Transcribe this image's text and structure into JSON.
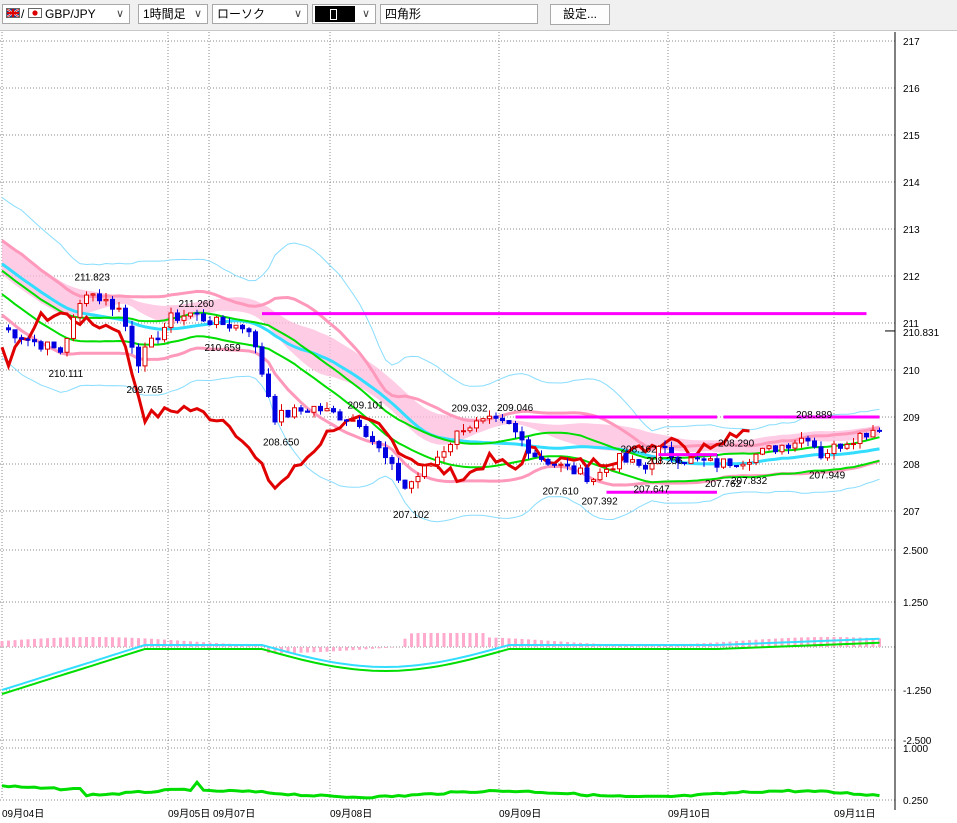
{
  "toolbar": {
    "pair": "GBP/JPY",
    "timeframe": "1時間足",
    "chart_style": "ローソク",
    "drawing_tool": "四角形",
    "settings_label": "設定..."
  },
  "colors": {
    "candle_up": "#e00000",
    "candle_down": "#0000e0",
    "lagging_span": "#e00000",
    "ma_green": "#00dd00",
    "ma_cyan": "#33ddff",
    "bb_outer": "#88ddff",
    "bb_pink": "#ff99bb",
    "cloud": "#ffbbdd",
    "levels": "#ff00ff",
    "grid": "#888888"
  },
  "chart_data": {
    "type": "candlestick",
    "title": "",
    "price_panel": {
      "y_ticks": [
        "217",
        "216",
        "215",
        "214",
        "213",
        "212",
        "211",
        "210",
        "209",
        "208",
        "207"
      ],
      "ylim": [
        206.5,
        217.2
      ],
      "current_price": "210.831",
      "x_ticks": [
        "09月04日",
        "09月05日",
        "09月07日",
        "09月08日",
        "09月09日",
        "09月10日",
        "09月11日"
      ],
      "annotations": [
        {
          "label": "211.823",
          "bar": 13
        },
        {
          "label": "211.260",
          "bar": 29
        },
        {
          "label": "210.111",
          "bar": 9
        },
        {
          "label": "209.765",
          "bar": 21
        },
        {
          "label": "210.659",
          "bar": 33
        },
        {
          "label": "208.650",
          "bar": 42
        },
        {
          "label": "209.101",
          "bar": 55
        },
        {
          "label": "207.102",
          "bar": 62
        },
        {
          "label": "209.032",
          "bar": 71
        },
        {
          "label": "209.046",
          "bar": 78
        },
        {
          "label": "207.610",
          "bar": 85
        },
        {
          "label": "207.392",
          "bar": 91
        },
        {
          "label": "208.162",
          "bar": 97
        },
        {
          "label": "207.647",
          "bar": 99
        },
        {
          "label": "208.256",
          "bar": 101
        },
        {
          "label": "207.762",
          "bar": 110
        },
        {
          "label": "208.290",
          "bar": 112
        },
        {
          "label": "207.832",
          "bar": 114
        },
        {
          "label": "208.889",
          "bar": 124
        },
        {
          "label": "207.949",
          "bar": 126
        }
      ],
      "levels": [
        {
          "price": 211.2,
          "from_bar": 40,
          "to_bar": 133
        },
        {
          "price": 209.0,
          "from_bar": 79,
          "to_bar": 110
        },
        {
          "price": 209.0,
          "from_bar": 111,
          "to_bar": 135
        },
        {
          "price": 208.2,
          "from_bar": 101,
          "to_bar": 110
        },
        {
          "price": 207.4,
          "from_bar": 93,
          "to_bar": 110
        }
      ]
    },
    "macd_panel": {
      "y_ticks": [
        "2.500",
        "1.250",
        "-1.250",
        "-2.500"
      ]
    },
    "rsi_panel": {
      "y_ticks": [
        "1.000",
        "0.250"
      ]
    }
  }
}
